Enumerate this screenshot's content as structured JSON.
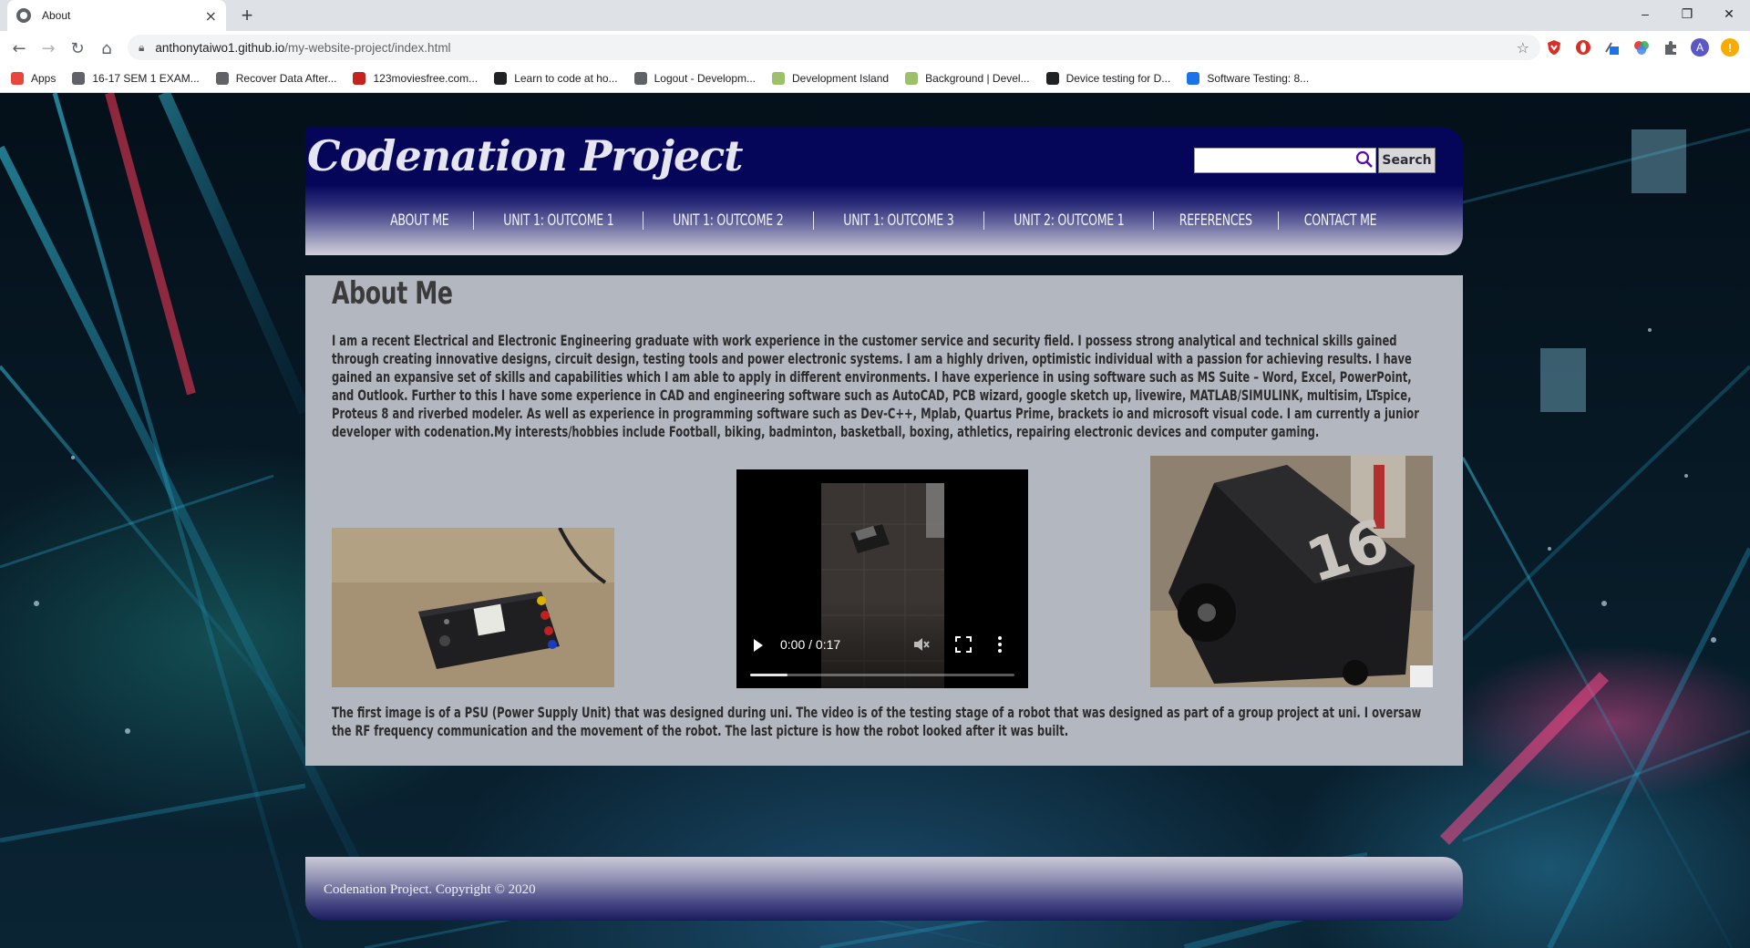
{
  "browser": {
    "tab_title": "About",
    "tab_close": "×",
    "new_tab": "+",
    "url_host": "anthonytaiwo1.github.io",
    "url_path": "/my-website-project/index.html",
    "window_controls": {
      "minimize": "–",
      "restore": "❐",
      "close": "✕"
    },
    "bookmarks": [
      {
        "label": "Apps",
        "color": "#e8453c"
      },
      {
        "label": "16-17 SEM 1 EXAM...",
        "color": "#5f6368"
      },
      {
        "label": "Recover Data After...",
        "color": "#5f6368"
      },
      {
        "label": "123moviesfree.com...",
        "color": "#c5221f"
      },
      {
        "label": "Learn to code at ho...",
        "color": "#202124"
      },
      {
        "label": "Logout - Developm...",
        "color": "#5f6368"
      },
      {
        "label": "Development Island",
        "color": "#9bc26a"
      },
      {
        "label": "Background | Devel...",
        "color": "#9bc26a"
      },
      {
        "label": "Device testing for D...",
        "color": "#202124"
      },
      {
        "label": "Software Testing: 8...",
        "color": "#1a73e8"
      }
    ],
    "profile_initial": "A"
  },
  "site": {
    "title": "Codenation Project",
    "search_placeholder": "",
    "search_button": "Search",
    "nav": [
      "ABOUT ME",
      "UNIT 1: OUTCOME 1",
      "UNIT 1: OUTCOME 2",
      "UNIT 1: OUTCOME 3",
      "UNIT 2: OUTCOME 1",
      "REFERENCES",
      "CONTACT ME"
    ]
  },
  "content": {
    "heading": "About Me",
    "paragraph": "I am a recent Electrical and Electronic Engineering graduate with work experience in the customer service and security field. I possess strong analytical and technical skills gained through creating innovative designs, circuit design, testing tools and power electronic systems. I am a highly driven, optimistic individual with a passion for achieving results. I have gained an expansive set of skills and capabilities which I am able to apply in different environments. I have experience in using software such as MS Suite – Word, Excel, PowerPoint, and Outlook. Further to this I have some experience in CAD and engineering software such as AutoCAD, PCB wizard, google sketch up, livewire, MATLAB/SIMULINK, multisim, LTspice, Proteus 8 and riverbed modeler. As well as experience in programming software such as Dev-C++, Mplab, Quartus Prime, brackets io and microsoft visual code. I am currently a junior developer with codenation.My interests/hobbies include Football, biking, badminton, basketball, boxing, athletics, repairing electronic devices and computer gaming.",
    "video_time": "0:00 / 0:17",
    "video_buffered_fraction": 0.14,
    "robot_number": "16",
    "caption": "The first image is of a PSU (Power Supply Unit) that was designed during uni. The video is of the testing stage of a robot that was designed as part of a group project at uni. I oversaw the RF frequency communication and the movement of the robot. The last picture is how the robot looked after it was built."
  },
  "footer": {
    "text": "Codenation Project. Copyright © 2020"
  }
}
